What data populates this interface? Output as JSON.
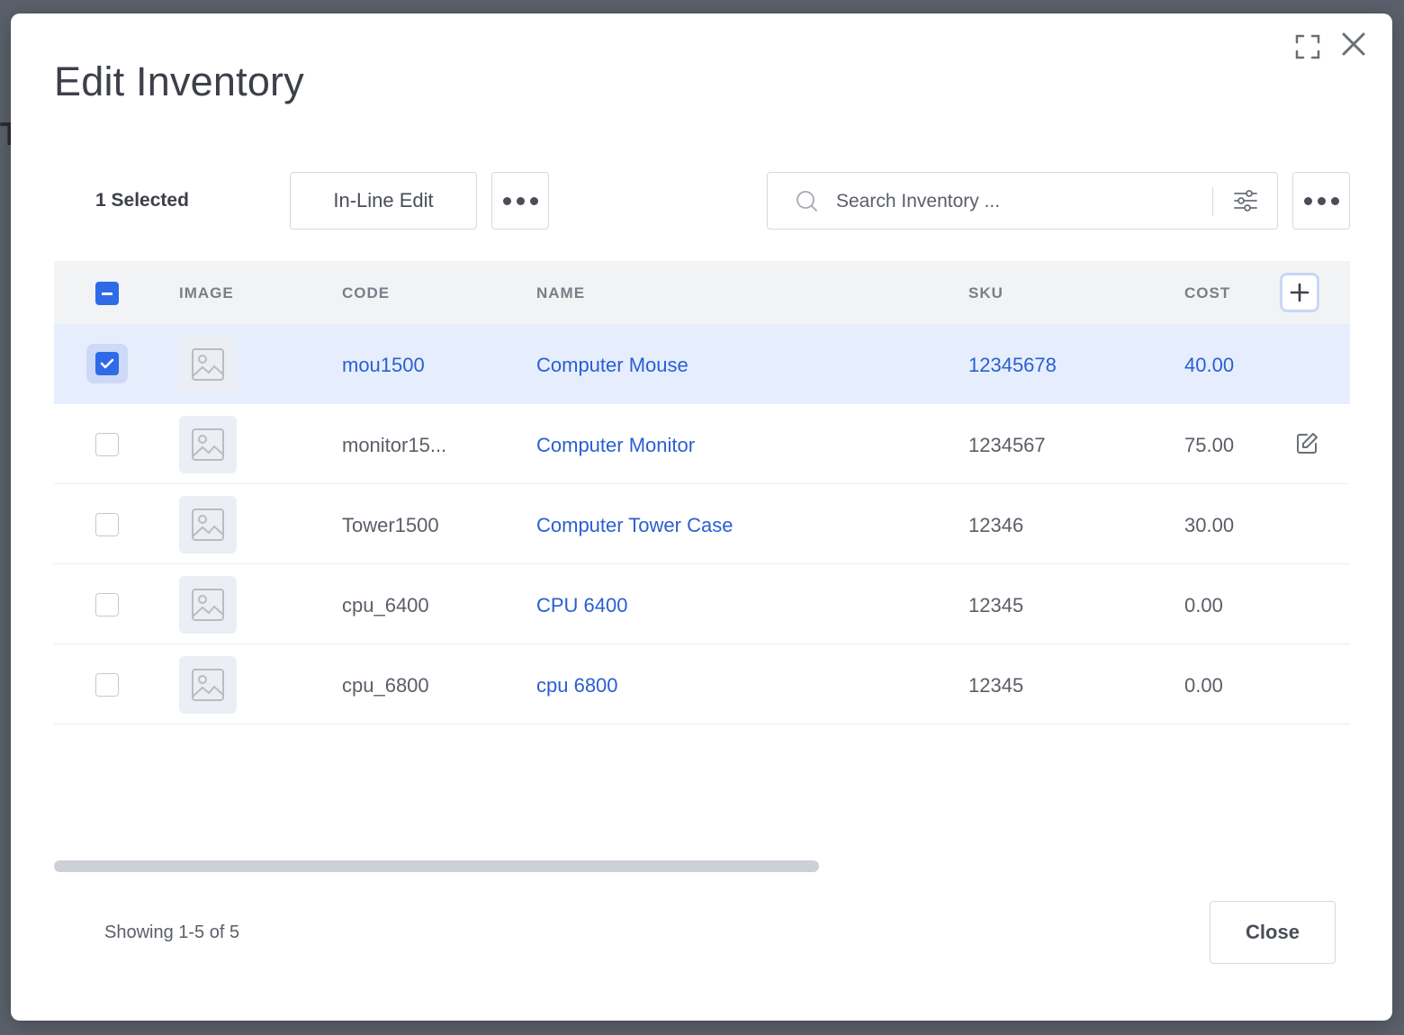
{
  "modal": {
    "title": "Edit Inventory",
    "close_label": "Close",
    "showing": "Showing 1-5 of 5"
  },
  "toolbar": {
    "selected_count": "1 Selected",
    "inline_edit_label": "In-Line Edit",
    "search_placeholder": "Search Inventory ...",
    "search_value": ""
  },
  "table": {
    "columns": [
      "IMAGE",
      "CODE",
      "NAME",
      "SKU",
      "COST"
    ],
    "rows": [
      {
        "code": "mou1500",
        "name": "Computer Mouse",
        "sku": "12345678",
        "cost": "40.00",
        "selected": true
      },
      {
        "code": "monitor15...",
        "name": "Computer Monitor",
        "sku": "1234567",
        "cost": "75.00",
        "selected": false
      },
      {
        "code": "Tower1500",
        "name": "Computer Tower Case",
        "sku": "12346",
        "cost": "30.00",
        "selected": false
      },
      {
        "code": "cpu_6400",
        "name": "CPU 6400",
        "sku": "12345",
        "cost": "0.00",
        "selected": false
      },
      {
        "code": "cpu_6800",
        "name": "cpu 6800",
        "sku": "12345",
        "cost": "0.00",
        "selected": false
      }
    ]
  },
  "colors": {
    "accent": "#2f6be8",
    "link": "#2a5fd1",
    "selected_row": "#e6eefd",
    "overlay": "#5b616c"
  },
  "icons": [
    "expand-icon",
    "close-icon",
    "search-icon",
    "filter-icon",
    "more-icon",
    "image-placeholder-icon",
    "add-column-icon",
    "edit-icon",
    "checkmark-icon"
  ]
}
